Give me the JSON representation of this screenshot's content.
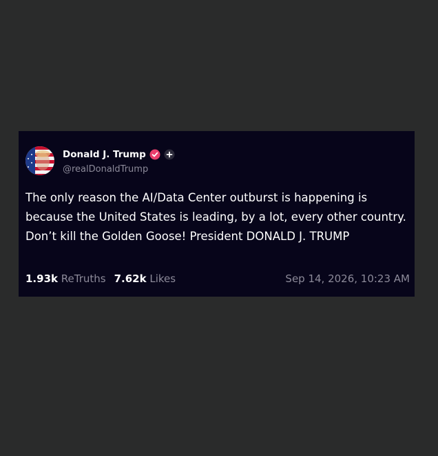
{
  "post": {
    "author": {
      "display_name": "Donald J. Trump",
      "handle": "@realDonaldTrump",
      "verified_icon": "verified-badge-icon",
      "plus_icon": "plus-icon"
    },
    "text": "The only reason the AI/Data Center outburst is happening is because the United States is leading, by a lot, every other country. Don’t kill the Golden Goose! President DONALD J. TRUMP",
    "retruths_count": "1.93k",
    "retruths_label": "ReTruths",
    "likes_count": "7.62k",
    "likes_label": "Likes",
    "timestamp": "Sep 14, 2026, 10:23 AM"
  },
  "colors": {
    "page_background": "#2a2b2b",
    "card_background": "#07051a",
    "verified_badge": "#e83e6c",
    "muted_text": "#8c8a99"
  }
}
